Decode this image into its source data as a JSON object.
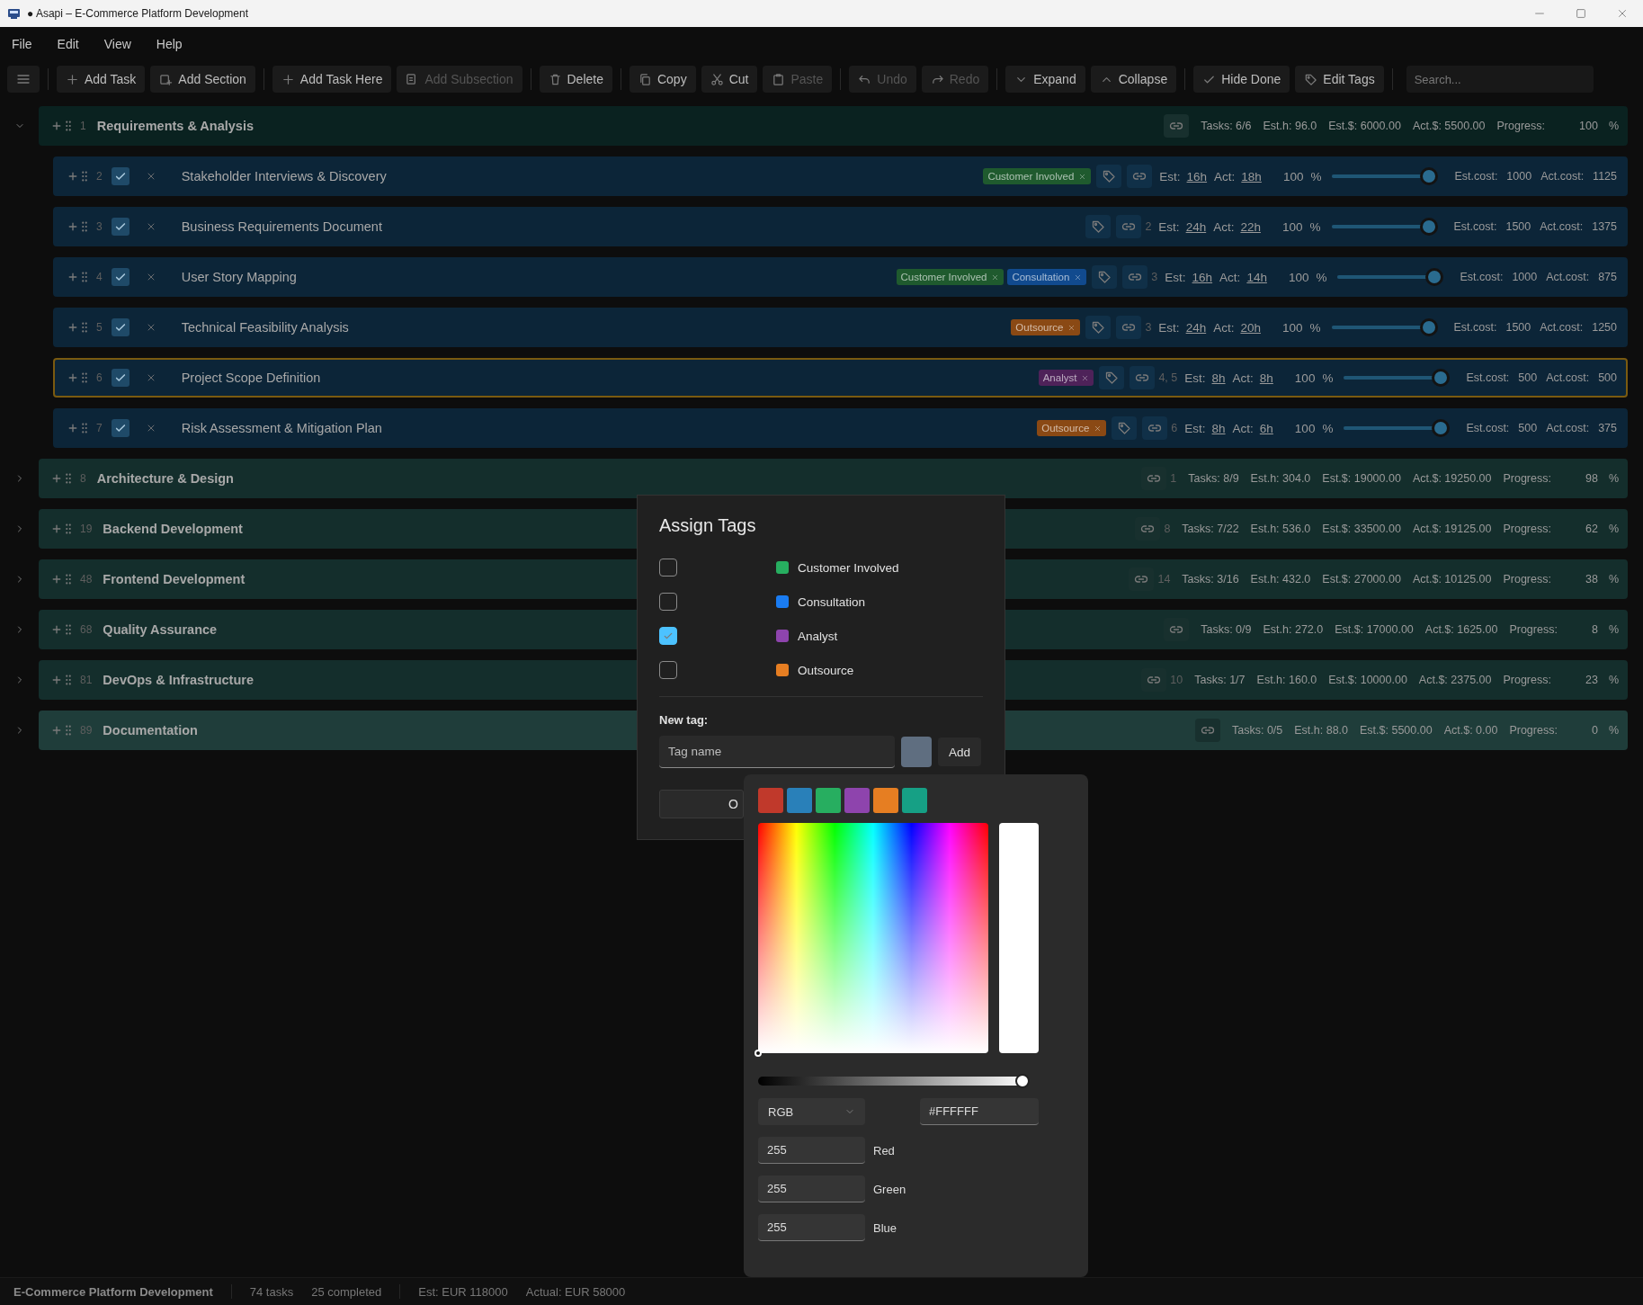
{
  "window": {
    "title": "● Asapi – E-Commerce Platform Development"
  },
  "menu": [
    "File",
    "Edit",
    "View",
    "Help"
  ],
  "toolbar": {
    "groups": [
      [
        {
          "label": "Add Task",
          "disabled": false
        },
        {
          "label": "Add Section",
          "disabled": false
        }
      ],
      [
        {
          "label": "Add Task Here",
          "disabled": false
        },
        {
          "label": "Add Subsection",
          "disabled": true
        }
      ],
      [
        {
          "label": "Delete",
          "disabled": false
        }
      ],
      [
        {
          "label": "Copy",
          "disabled": false
        },
        {
          "label": "Cut",
          "disabled": false
        },
        {
          "label": "Paste",
          "disabled": true
        }
      ],
      [
        {
          "label": "Undo",
          "disabled": true
        },
        {
          "label": "Redo",
          "disabled": true
        }
      ],
      [
        {
          "label": "Expand",
          "disabled": false
        },
        {
          "label": "Collapse",
          "disabled": false
        }
      ],
      [
        {
          "label": "Hide Done",
          "disabled": false
        },
        {
          "label": "Edit Tags",
          "disabled": false
        }
      ]
    ],
    "search": {
      "placeholder": "Search..."
    }
  },
  "sections": [
    {
      "number": "1",
      "title": "Requirements & Analysis",
      "expanded": true,
      "hovered": false,
      "tasks": "Tasks: 6/6",
      "est_h": "Est.h: 96.0",
      "est_cost": "Est.$: 6000.00",
      "act_cost": "Act.$: 5500.00",
      "progress_label": "Progress:",
      "progress": "100",
      "unit": "%",
      "items": [
        {
          "number": "2",
          "done": true,
          "selected": false,
          "title": "Stakeholder Interviews & Discovery",
          "tags": [
            {
              "label": "Customer Involved",
              "color": "#1f5a2e"
            }
          ],
          "est_label": "Est:",
          "est": "16h",
          "act_label": "Act:",
          "act": "18h",
          "progress": "100",
          "unit": "%",
          "level": 1,
          "est_cost_label": "Est.cost:",
          "est_cost": "1000",
          "act_cost_label": "Act.cost:",
          "act_cost": "1125"
        },
        {
          "number": "3",
          "done": true,
          "selected": false,
          "title": "Business Requirements Document",
          "deps": "2",
          "est_label": "Est:",
          "est": "24h",
          "act_label": "Act:",
          "act": "22h",
          "progress": "100",
          "unit": "%",
          "level": 1,
          "est_cost_label": "Est.cost:",
          "est_cost": "1500",
          "act_cost_label": "Act.cost:",
          "act_cost": "1375"
        },
        {
          "number": "4",
          "done": true,
          "selected": false,
          "title": "User Story Mapping",
          "tags": [
            {
              "label": "Customer Involved",
              "color": "#1f5a2e"
            },
            {
              "label": "Consultation",
              "color": "#114a8e"
            }
          ],
          "deps": "3",
          "est_label": "Est:",
          "est": "16h",
          "act_label": "Act:",
          "act": "14h",
          "progress": "100",
          "unit": "%",
          "level": 1,
          "est_cost_label": "Est.cost:",
          "est_cost": "1000",
          "act_cost_label": "Act.cost:",
          "act_cost": "875"
        },
        {
          "number": "5",
          "done": true,
          "selected": false,
          "title": "Technical Feasibility Analysis",
          "tags": [
            {
              "label": "Outsource",
              "color": "#8a4914"
            }
          ],
          "deps": "3",
          "est_label": "Est:",
          "est": "24h",
          "act_label": "Act:",
          "act": "20h",
          "progress": "100",
          "unit": "%",
          "level": 1,
          "est_cost_label": "Est.cost:",
          "est_cost": "1500",
          "act_cost_label": "Act.cost:",
          "act_cost": "1250"
        },
        {
          "number": "6",
          "done": true,
          "selected": true,
          "title": "Project Scope Definition",
          "tags": [
            {
              "label": "Analyst",
              "color": "#4e2259"
            }
          ],
          "deps": "4, 5",
          "est_label": "Est:",
          "est": "8h",
          "act_label": "Act:",
          "act": "8h",
          "progress": "100",
          "unit": "%",
          "level": 1,
          "est_cost_label": "Est.cost:",
          "est_cost": "500",
          "act_cost_label": "Act.cost:",
          "act_cost": "500"
        },
        {
          "number": "7",
          "done": true,
          "selected": false,
          "title": "Risk Assessment & Mitigation Plan",
          "tags": [
            {
              "label": "Outsource",
              "color": "#8a4914"
            }
          ],
          "deps": "6",
          "est_label": "Est:",
          "est": "8h",
          "act_label": "Act:",
          "act": "6h",
          "progress": "100",
          "unit": "%",
          "level": 1,
          "est_cost_label": "Est.cost:",
          "est_cost": "500",
          "act_cost_label": "Act.cost:",
          "act_cost": "375"
        }
      ]
    },
    {
      "number": "8",
      "title": "Architecture & Design",
      "expanded": false,
      "hovered": false,
      "links": "1",
      "tasks": "Tasks: 8/9",
      "est_h": "Est.h: 304.0",
      "est_cost": "Est.$: 19000.00",
      "act_cost": "Act.$: 19250.00",
      "progress_label": "Progress:",
      "progress": "98",
      "unit": "%"
    },
    {
      "number": "19",
      "title": "Backend Development",
      "expanded": false,
      "hovered": false,
      "links": "8",
      "tasks": "Tasks: 7/22",
      "est_h": "Est.h: 536.0",
      "est_cost": "Est.$: 33500.00",
      "act_cost": "Act.$: 19125.00",
      "progress_label": "Progress:",
      "progress": "62",
      "unit": "%"
    },
    {
      "number": "48",
      "title": "Frontend Development",
      "expanded": false,
      "hovered": false,
      "links": "14",
      "tasks": "Tasks: 3/16",
      "est_h": "Est.h: 432.0",
      "est_cost": "Est.$: 27000.00",
      "act_cost": "Act.$: 10125.00",
      "progress_label": "Progress:",
      "progress": "38",
      "unit": "%"
    },
    {
      "number": "68",
      "title": "Quality Assurance",
      "expanded": false,
      "hovered": false,
      "tasks": "Tasks: 0/9",
      "est_h": "Est.h: 272.0",
      "est_cost": "Est.$: 17000.00",
      "act_cost": "Act.$: 1625.00",
      "progress_label": "Progress:",
      "progress": "8",
      "unit": "%"
    },
    {
      "number": "81",
      "title": "DevOps & Infrastructure",
      "expanded": false,
      "hovered": false,
      "links": "10",
      "tasks": "Tasks: 1/7",
      "est_h": "Est.h: 160.0",
      "est_cost": "Est.$: 10000.00",
      "act_cost": "Act.$: 2375.00",
      "progress_label": "Progress:",
      "progress": "23",
      "unit": "%"
    },
    {
      "number": "89",
      "title": "Documentation",
      "expanded": false,
      "hovered": true,
      "tasks": "Tasks: 0/5",
      "est_h": "Est.h: 88.0",
      "est_cost": "Est.$: 5500.00",
      "act_cost": "Act.$: 0.00",
      "progress_label": "Progress:",
      "progress": "0",
      "unit": "%"
    }
  ],
  "dialog": {
    "title": "Assign Tags",
    "tags": [
      {
        "label": "Customer Involved",
        "color": "#27ae60",
        "checked": false
      },
      {
        "label": "Consultation",
        "color": "#1a7cf2",
        "checked": false
      },
      {
        "label": "Analyst",
        "color": "#8e44ad",
        "checked": true
      },
      {
        "label": "Outsource",
        "color": "#e67e22",
        "checked": false
      }
    ],
    "new_tag_label": "New tag:",
    "name_field": {
      "placeholder": "Tag name"
    },
    "new_tag_swatch": {
      "color": "#5f6e80"
    },
    "add_button": "Add",
    "ok_button": "O"
  },
  "color_picker": {
    "swatches": [
      {
        "color": "#c0392b"
      },
      {
        "color": "#2980b9"
      },
      {
        "color": "#27ae60"
      },
      {
        "color": "#8e44ad"
      },
      {
        "color": "#e67e22"
      },
      {
        "color": "#16a085"
      }
    ],
    "preview": {
      "color": "#ffffff"
    },
    "level": 1,
    "mode": "RGB",
    "hex": "#FFFFFF",
    "channels": [
      {
        "value": "255",
        "label": "Red"
      },
      {
        "value": "255",
        "label": "Green"
      },
      {
        "value": "255",
        "label": "Blue"
      }
    ]
  },
  "status_bar": {
    "project": "E-Commerce Platform Development",
    "tasks": "74 tasks",
    "completed": "25 completed",
    "estimate": "Est: EUR 118000",
    "actual": "Actual: EUR 58000"
  }
}
